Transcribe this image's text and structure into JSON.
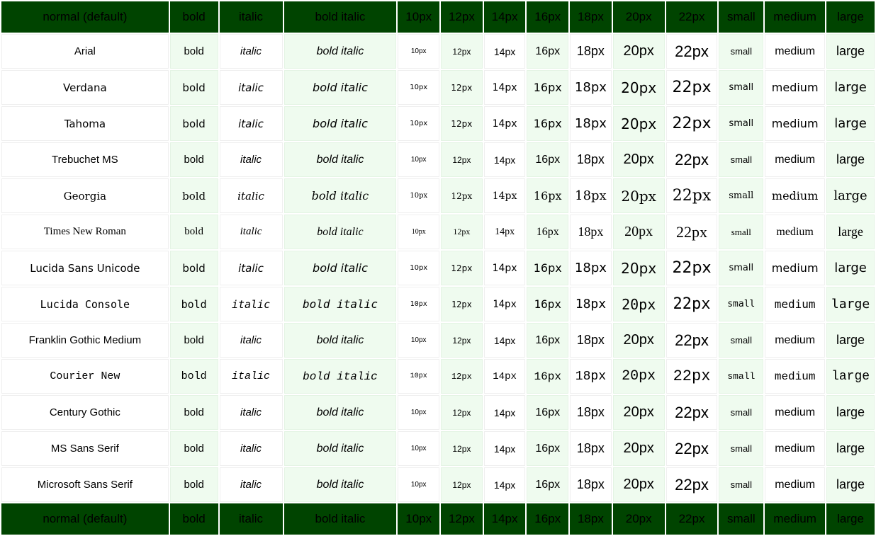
{
  "table": {
    "columns": [
      "normal (default)",
      "bold",
      "italic",
      "bold italic",
      "10px",
      "12px",
      "14px",
      "16px",
      "18px",
      "20px",
      "22px",
      "small",
      "medium",
      "large"
    ],
    "header_bg": "#004400",
    "header_color": "#00cc33",
    "tint_bg": "#effbef",
    "cell_bg": "#ffffff",
    "border_color": "#efefef",
    "rows": [
      {
        "name": "Arial",
        "cells": [
          "bold",
          "italic",
          "bold italic",
          "10px",
          "12px",
          "14px",
          "16px",
          "18px",
          "20px",
          "22px",
          "small",
          "medium",
          "large"
        ]
      },
      {
        "name": "Verdana",
        "cells": [
          "bold",
          "italic",
          "bold italic",
          "10px",
          "12px",
          "14px",
          "16px",
          "18px",
          "20px",
          "22px",
          "small",
          "medium",
          "large"
        ]
      },
      {
        "name": "Tahoma",
        "cells": [
          "bold",
          "italic",
          "bold italic",
          "10px",
          "12px",
          "14px",
          "16px",
          "18px",
          "20px",
          "22px",
          "small",
          "medium",
          "large"
        ]
      },
      {
        "name": "Trebuchet MS",
        "cells": [
          "bold",
          "italic",
          "bold italic",
          "10px",
          "12px",
          "14px",
          "16px",
          "18px",
          "20px",
          "22px",
          "small",
          "medium",
          "large"
        ]
      },
      {
        "name": "Georgia",
        "cells": [
          "bold",
          "italic",
          "bold italic",
          "10px",
          "12px",
          "14px",
          "16px",
          "18px",
          "20px",
          "22px",
          "small",
          "medium",
          "large"
        ]
      },
      {
        "name": "Times New Roman",
        "cells": [
          "bold",
          "italic",
          "bold italic",
          "10px",
          "12px",
          "14px",
          "16px",
          "18px",
          "20px",
          "22px",
          "small",
          "medium",
          "large"
        ]
      },
      {
        "name": "Lucida Sans Unicode",
        "cells": [
          "bold",
          "italic",
          "bold italic",
          "10px",
          "12px",
          "14px",
          "16px",
          "18px",
          "20px",
          "22px",
          "small",
          "medium",
          "large"
        ]
      },
      {
        "name": "Lucida Console",
        "cells": [
          "bold",
          "italic",
          "bold italic",
          "10px",
          "12px",
          "14px",
          "16px",
          "18px",
          "20px",
          "22px",
          "small",
          "medium",
          "large"
        ]
      },
      {
        "name": "Franklin Gothic Medium",
        "cells": [
          "bold",
          "italic",
          "bold italic",
          "10px",
          "12px",
          "14px",
          "16px",
          "18px",
          "20px",
          "22px",
          "small",
          "medium",
          "large"
        ]
      },
      {
        "name": "Courier New",
        "cells": [
          "bold",
          "italic",
          "bold italic",
          "10px",
          "12px",
          "14px",
          "16px",
          "18px",
          "20px",
          "22px",
          "small",
          "medium",
          "large"
        ]
      },
      {
        "name": "Century Gothic",
        "cells": [
          "bold",
          "italic",
          "bold italic",
          "10px",
          "12px",
          "14px",
          "16px",
          "18px",
          "20px",
          "22px",
          "small",
          "medium",
          "large"
        ]
      },
      {
        "name": "MS Sans Serif",
        "cells": [
          "bold",
          "italic",
          "bold italic",
          "10px",
          "12px",
          "14px",
          "16px",
          "18px",
          "20px",
          "22px",
          "small",
          "medium",
          "large"
        ]
      },
      {
        "name": "Microsoft Sans Serif",
        "cells": [
          "bold",
          "italic",
          "bold italic",
          "10px",
          "12px",
          "14px",
          "16px",
          "18px",
          "20px",
          "22px",
          "small",
          "medium",
          "large"
        ]
      }
    ]
  }
}
